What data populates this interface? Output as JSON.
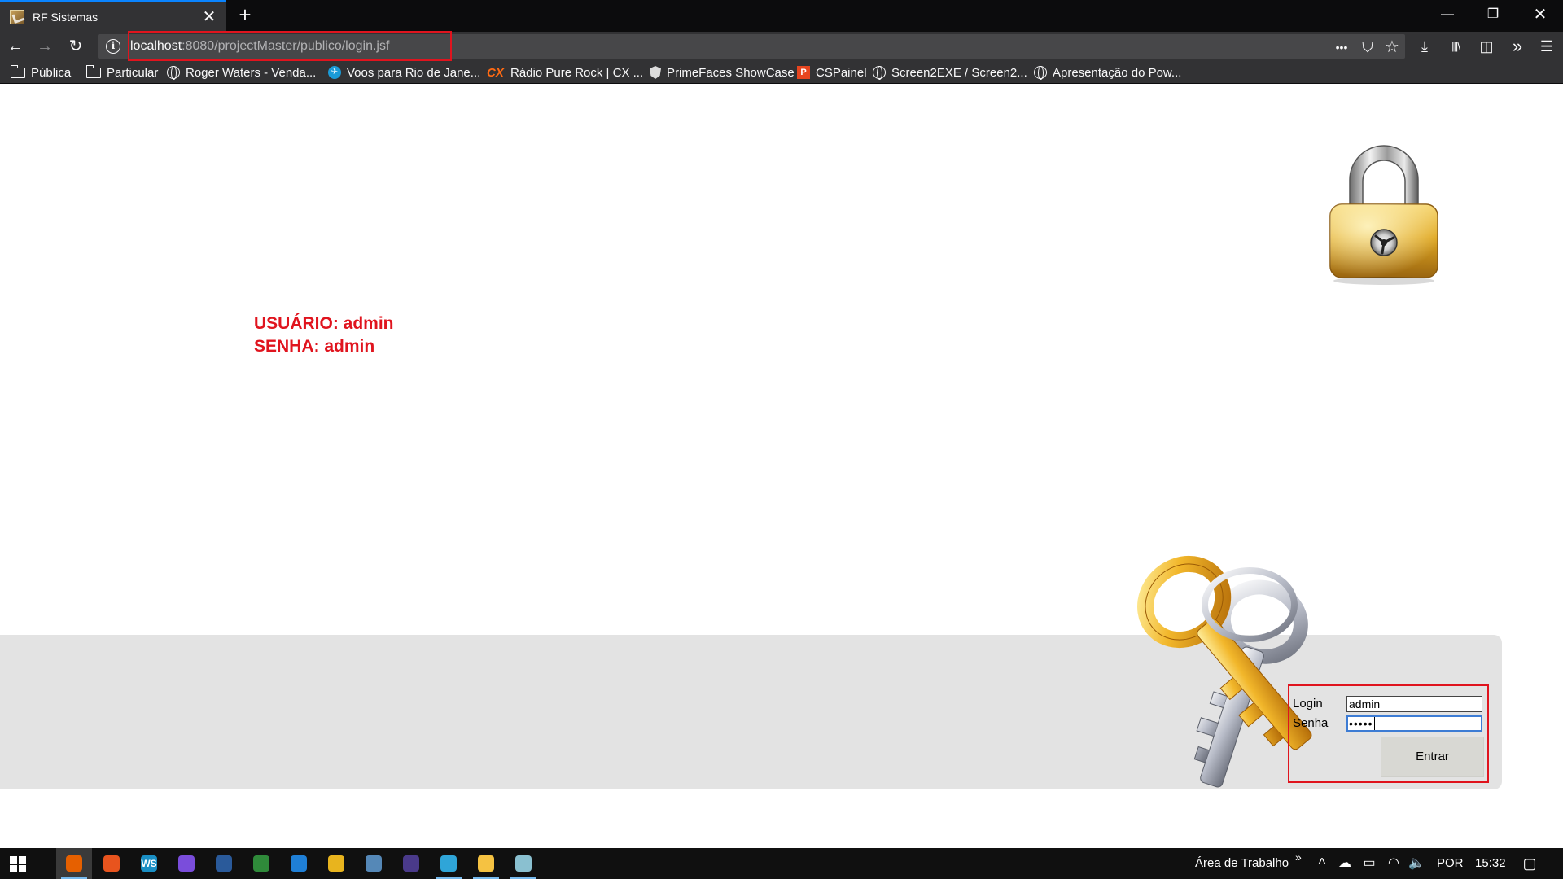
{
  "browser": {
    "tab_title": "RF Sistemas",
    "tab_close": "✕",
    "new_tab": "+",
    "url_host": "localhost",
    "url_rest": ":8080/projectMaster/publico/login.jsf",
    "url_info_glyph": "i",
    "window_controls": {
      "minimize": "—",
      "restore": "❐",
      "close": "✕"
    },
    "nav": {
      "back": "←",
      "forward": "→",
      "reload": "↻"
    },
    "url_actions": {
      "more": "•••",
      "pocket": "⛉",
      "bookmark": "☆"
    },
    "toolbar": {
      "downloads": "⤓",
      "library": "|||\\",
      "sidebar": "◫",
      "overflow": "»",
      "menu": "☰"
    }
  },
  "bookmarks": [
    {
      "label": "Pública",
      "icon": "folder-icon"
    },
    {
      "label": "Particular",
      "icon": "folder-icon"
    },
    {
      "label": "Roger Waters - Venda...",
      "icon": "globe-icon"
    },
    {
      "label": "Voos para Rio de Jane...",
      "icon": "plane-icon"
    },
    {
      "label": "Rádio Pure Rock | CX ...",
      "icon": "cx-icon"
    },
    {
      "label": "PrimeFaces ShowCase",
      "icon": "primefaces-icon"
    },
    {
      "label": "CSPainel",
      "icon": "cspainel-icon"
    },
    {
      "label": "Screen2EXE / Screen2...",
      "icon": "globe-icon"
    },
    {
      "label": "Apresentação do Pow...",
      "icon": "globe-icon"
    }
  ],
  "page": {
    "credentials_user": "USUÁRIO: admin",
    "credentials_pass": "SENHA: admin",
    "login_form": {
      "login_label": "Login",
      "login_value": "admin",
      "password_label": "Senha",
      "password_value": "•••••",
      "submit_label": "Entrar"
    }
  },
  "taskbar": {
    "apps": [
      {
        "name": "firefox",
        "glyph": "",
        "color": "#e66000"
      },
      {
        "name": "git-client",
        "glyph": "",
        "color": "#e8541e"
      },
      {
        "name": "webstorm",
        "glyph": "WS",
        "color": "#1a8fc4"
      },
      {
        "name": "messenger",
        "glyph": "",
        "color": "#7a4ddb"
      },
      {
        "name": "sql-tool",
        "glyph": "",
        "color": "#2a5a9a"
      },
      {
        "name": "spreadsheet",
        "glyph": "",
        "color": "#2f8a3a"
      },
      {
        "name": "vscode",
        "glyph": "",
        "color": "#1f7fd6"
      },
      {
        "name": "chrome",
        "glyph": "",
        "color": "#e8b41e"
      },
      {
        "name": "postgres",
        "glyph": "",
        "color": "#5588b7"
      },
      {
        "name": "eclipse",
        "glyph": "",
        "color": "#4a3a8a"
      },
      {
        "name": "sync-app",
        "glyph": "",
        "color": "#2fa5d8"
      },
      {
        "name": "file-explorer",
        "glyph": "",
        "color": "#f5c242"
      },
      {
        "name": "misc-app",
        "glyph": "",
        "color": "#8ac0d0"
      }
    ],
    "desktop_label": "Área de Trabalho",
    "desktop_chevron": "»",
    "tray_up": "^",
    "language": "POR",
    "clock": "15:32"
  }
}
